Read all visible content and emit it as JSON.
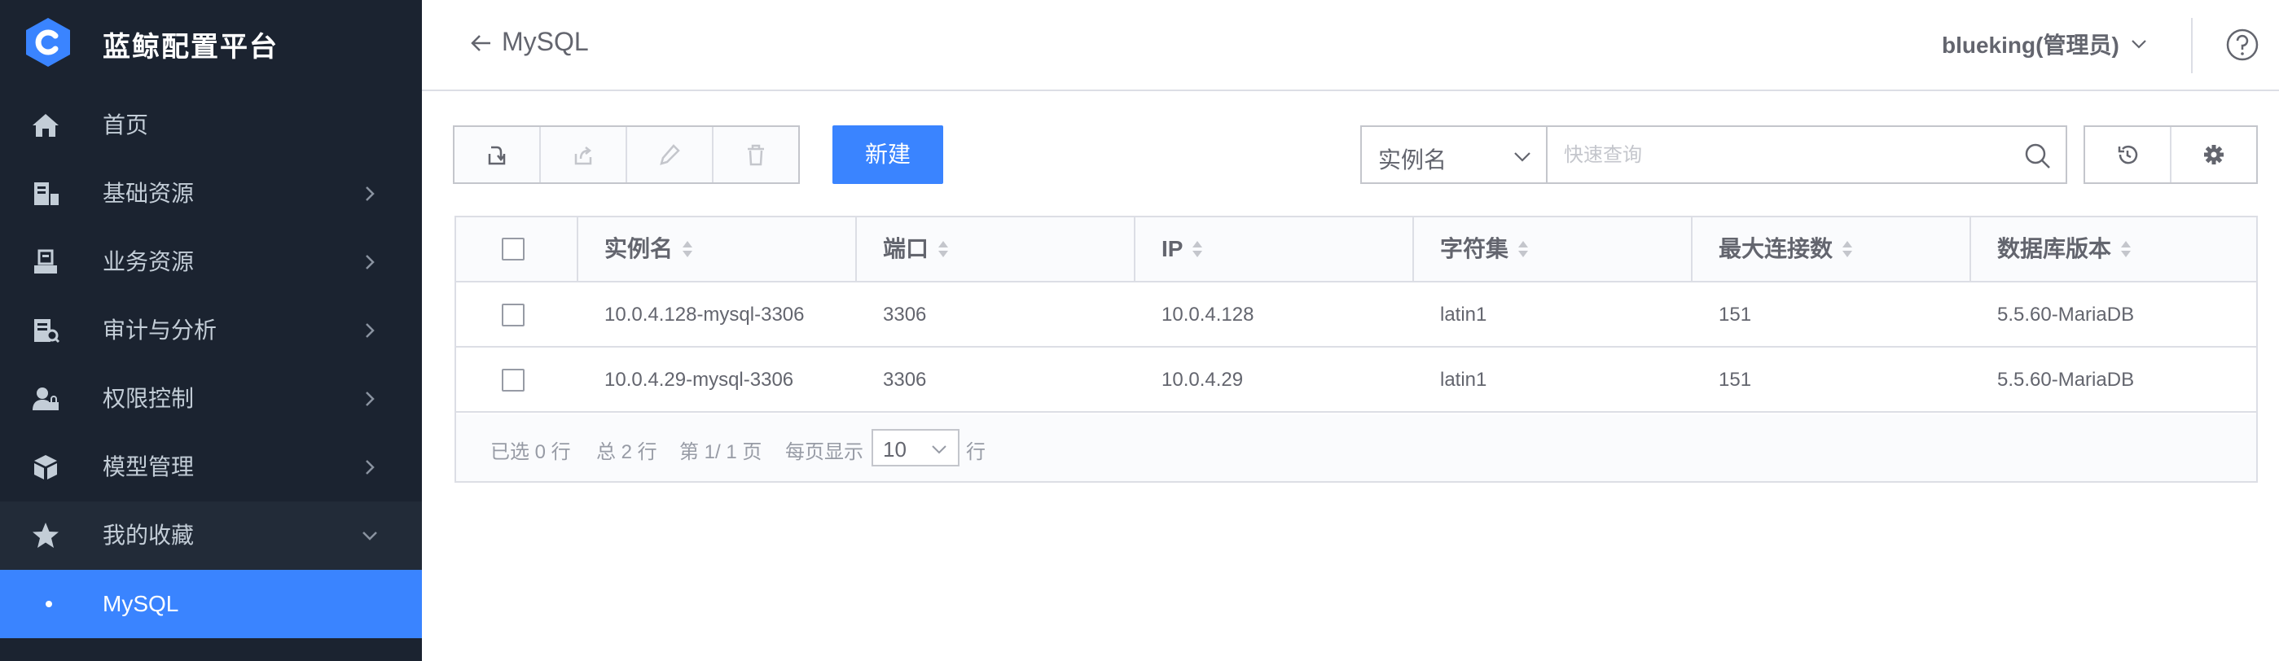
{
  "brand": {
    "title": "蓝鲸配置平台"
  },
  "sidebar": {
    "items": [
      {
        "label": "首页",
        "icon": "home-icon",
        "has_arrow": false
      },
      {
        "label": "基础资源",
        "icon": "resource-icon",
        "has_arrow": true
      },
      {
        "label": "业务资源",
        "icon": "business-icon",
        "has_arrow": true
      },
      {
        "label": "审计与分析",
        "icon": "audit-icon",
        "has_arrow": true
      },
      {
        "label": "权限控制",
        "icon": "permission-icon",
        "has_arrow": true
      },
      {
        "label": "模型管理",
        "icon": "model-icon",
        "has_arrow": true
      },
      {
        "label": "我的收藏",
        "icon": "star-icon",
        "has_arrow": true,
        "expanded": true
      },
      {
        "label": "MySQL",
        "active": true
      }
    ]
  },
  "header": {
    "title": "MySQL",
    "user": "blueking(管理员)"
  },
  "toolbar": {
    "create_label": "新建",
    "field_select": "实例名",
    "search_placeholder": "快速查询"
  },
  "table": {
    "columns": [
      "实例名",
      "端口",
      "IP",
      "字符集",
      "最大连接数",
      "数据库版本"
    ],
    "rows": [
      [
        "10.0.4.128-mysql-3306",
        "3306",
        "10.0.4.128",
        "latin1",
        "151",
        "5.5.60-MariaDB"
      ],
      [
        "10.0.4.29-mysql-3306",
        "3306",
        "10.0.4.29",
        "latin1",
        "151",
        "5.5.60-MariaDB"
      ]
    ]
  },
  "footer": {
    "selected": "已选 0 行",
    "total": "总 2 行",
    "page": "第 1/ 1 页",
    "per_page_label": "每页显示",
    "page_size": "10",
    "row_unit": "行"
  },
  "colors": {
    "accent": "#3a84ff",
    "sidebar_bg": "#1b2330"
  }
}
